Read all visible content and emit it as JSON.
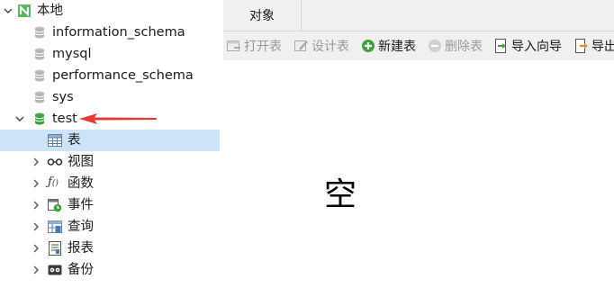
{
  "tree": {
    "root": {
      "label": "本地"
    },
    "databases": [
      {
        "label": "information_schema"
      },
      {
        "label": "mysql"
      },
      {
        "label": "performance_schema"
      },
      {
        "label": "sys"
      },
      {
        "label": "test"
      }
    ],
    "children": [
      {
        "label": "表",
        "icon": "table-icon"
      },
      {
        "label": "视图",
        "icon": "view-glasses-icon"
      },
      {
        "label": "函数",
        "icon": "function-icon"
      },
      {
        "label": "事件",
        "icon": "event-clock-icon"
      },
      {
        "label": "查询",
        "icon": "query-icon"
      },
      {
        "label": "报表",
        "icon": "report-icon"
      },
      {
        "label": "备份",
        "icon": "backup-icon"
      }
    ]
  },
  "tabs": {
    "objects": "对象"
  },
  "toolbar": {
    "open_table": "打开表",
    "design_table": "设计表",
    "new_table": "新建表",
    "delete_table": "删除表",
    "import_wizard": "导入向导",
    "export_wizard": "导出"
  },
  "content": {
    "empty_text": "空"
  },
  "colors": {
    "selection": "#cce4f7",
    "annotation_arrow": "#e53935",
    "db_connected": "#3aa33a",
    "db_idle": "#b5b5b5"
  }
}
